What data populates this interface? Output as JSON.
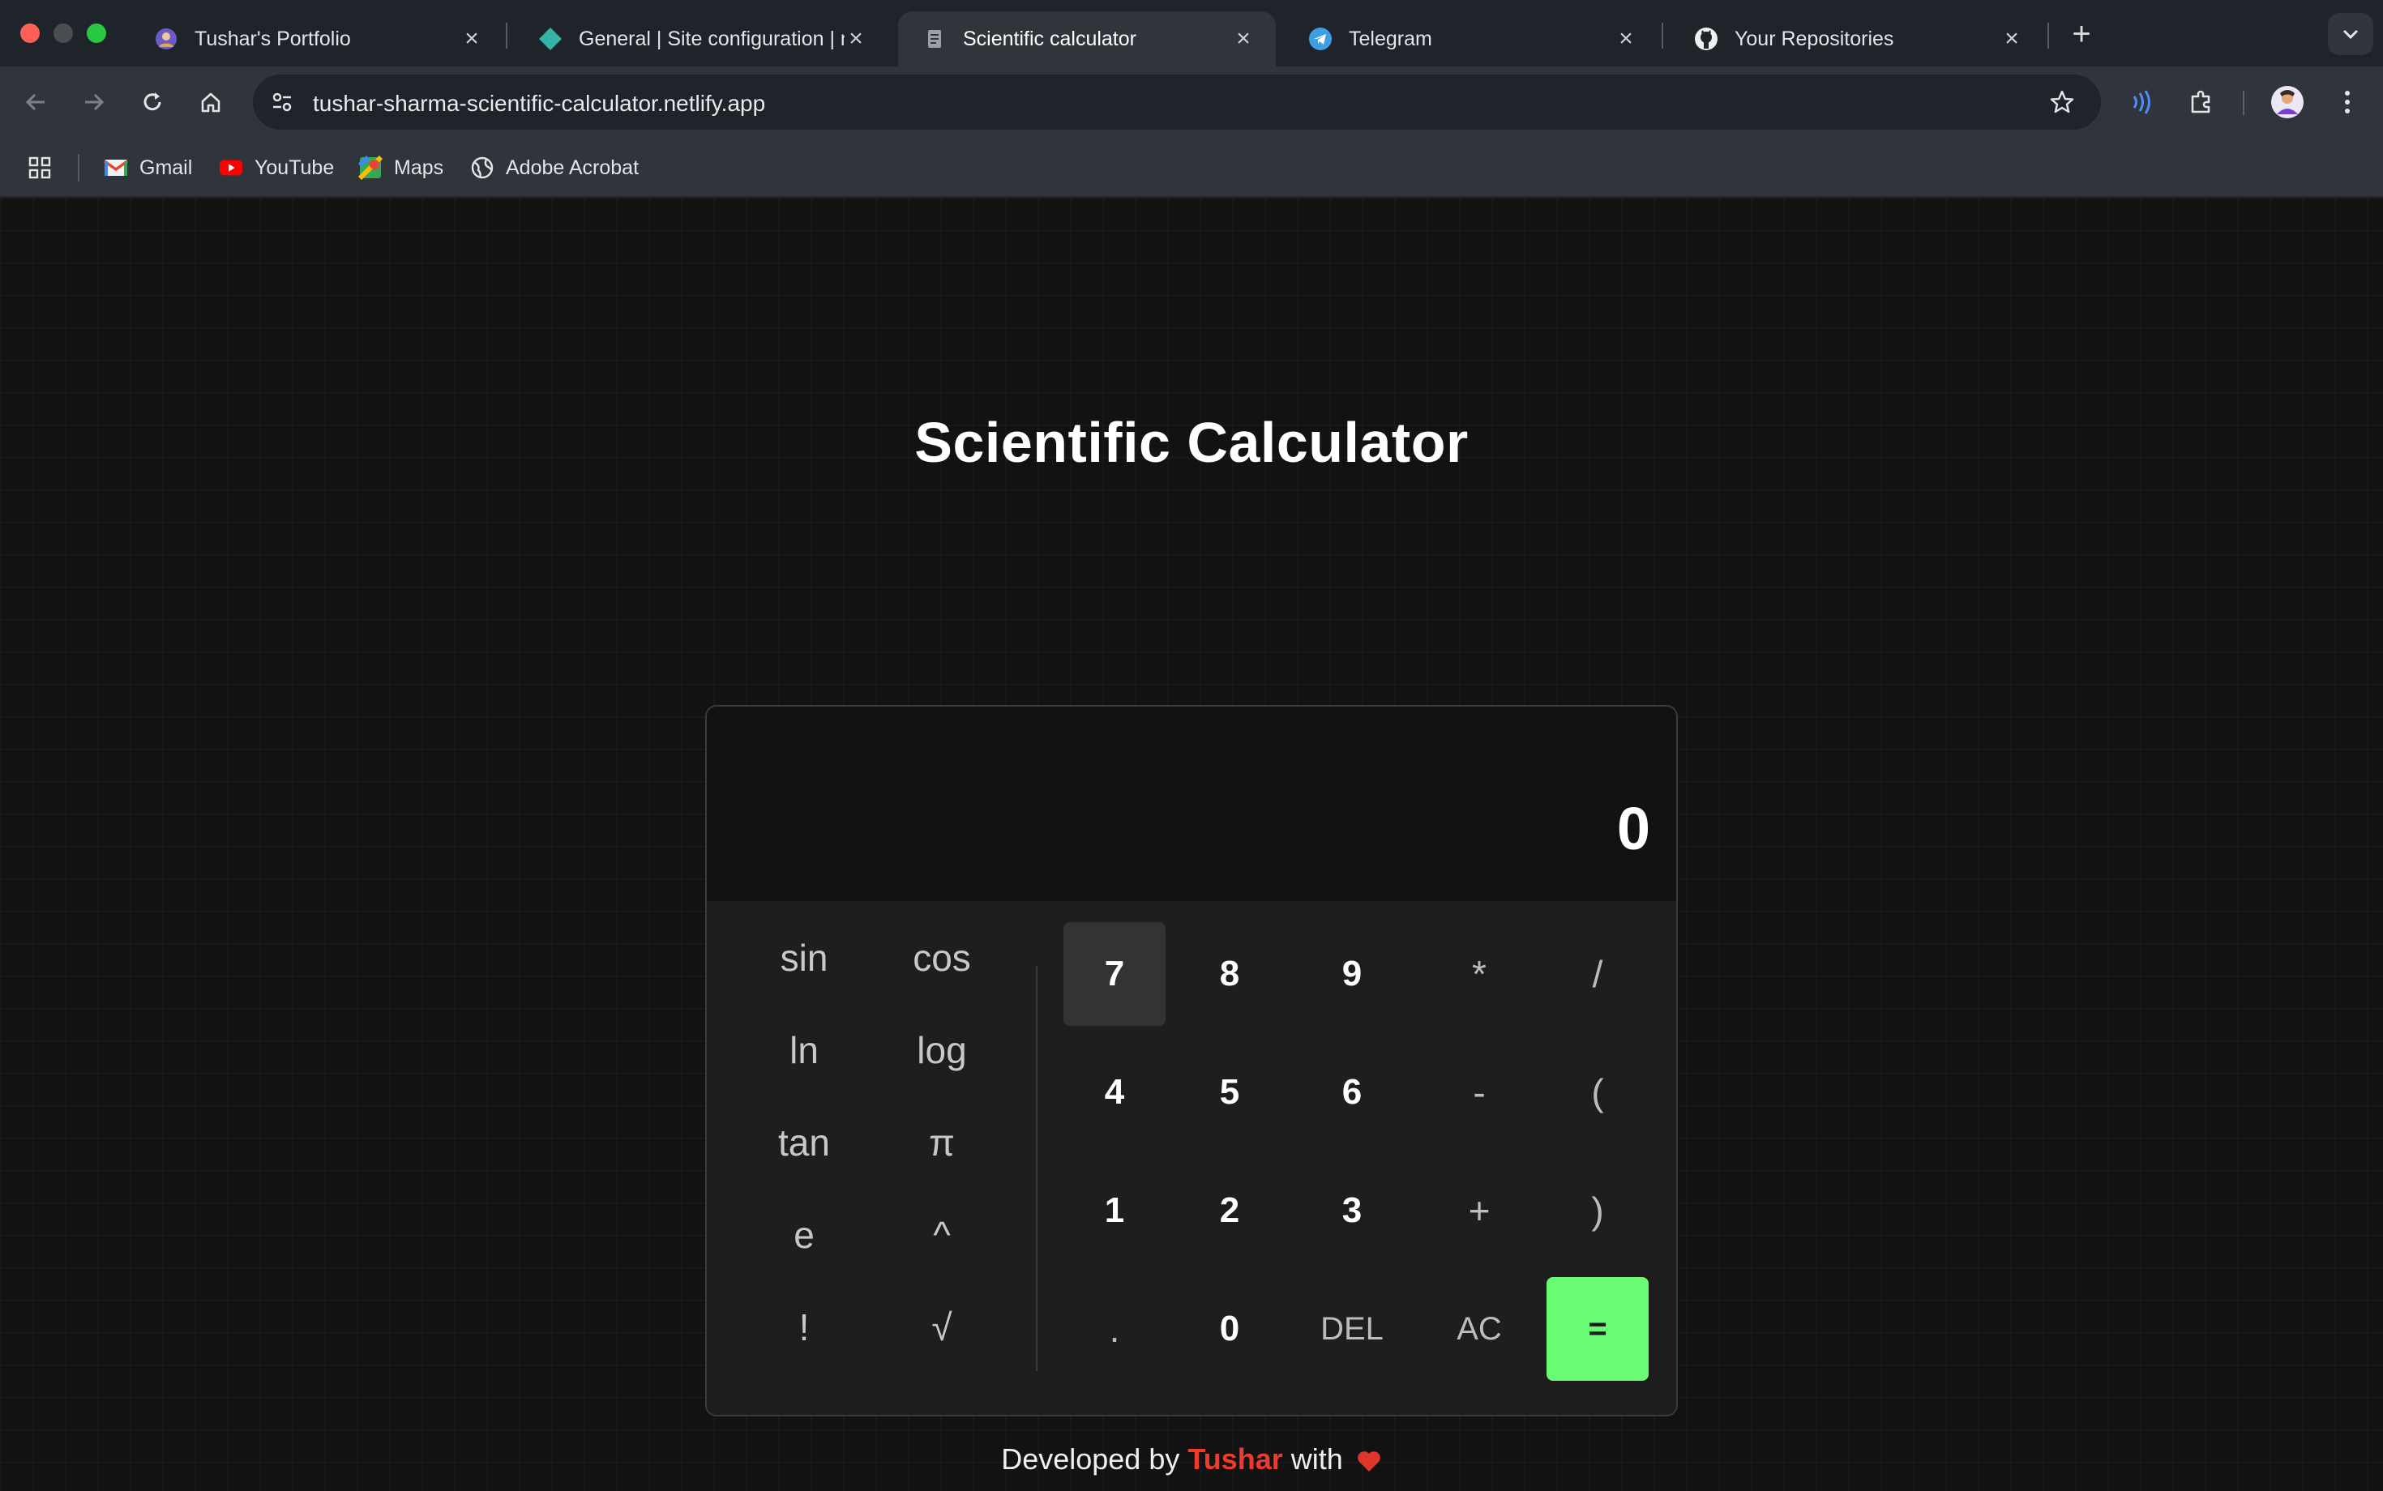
{
  "browser": {
    "tabs": [
      {
        "title": "Tushar's Portfolio",
        "favicon": "avatar-favicon-icon"
      },
      {
        "title": "General | Site configuration | n",
        "favicon": "netlify-diamond-icon"
      },
      {
        "title": "Scientific calculator",
        "favicon": "document-icon"
      },
      {
        "title": "Telegram",
        "favicon": "telegram-icon"
      },
      {
        "title": "Your Repositories",
        "favicon": "github-icon"
      }
    ],
    "active_tab": 2,
    "url": "tushar-sharma-scientific-calculator.netlify.app",
    "bookmarks": [
      {
        "label": "Gmail",
        "icon": "gmail-icon"
      },
      {
        "label": "YouTube",
        "icon": "youtube-icon"
      },
      {
        "label": "Maps",
        "icon": "maps-icon"
      },
      {
        "label": "Adobe Acrobat",
        "icon": "globe-icon"
      }
    ]
  },
  "page": {
    "title": "Scientific Calculator",
    "display_value": "0",
    "scientific_keys": [
      "sin",
      "cos",
      "ln",
      "log",
      "tan",
      "π",
      "e",
      "^",
      "!",
      "√"
    ],
    "main_keys": [
      [
        "7",
        "8",
        "9",
        "*",
        "/"
      ],
      [
        "4",
        "5",
        "6",
        "-",
        "("
      ],
      [
        "1",
        "2",
        "3",
        "+",
        ")"
      ],
      [
        ".",
        "0",
        "DEL",
        "AC",
        "="
      ]
    ],
    "footer": {
      "prefix": "Developed by",
      "name": "Tushar",
      "suffix": "with"
    },
    "colors": {
      "accent_equals": "#69fb74",
      "name_red": "#ef3b2d",
      "background": "#121212"
    }
  }
}
